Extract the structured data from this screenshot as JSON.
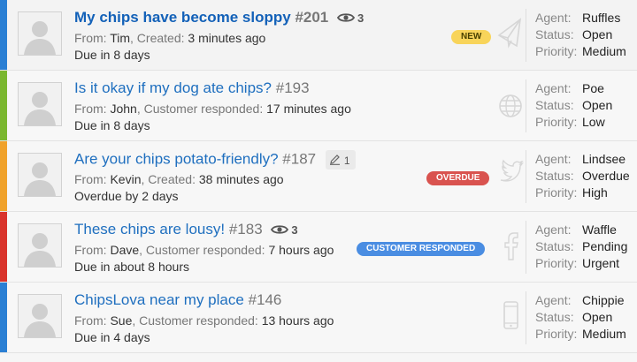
{
  "tickets": [
    {
      "title": "My chips have become sloppy",
      "number": "#201",
      "bold": true,
      "viewers": "3",
      "stripe_color": "#2a7fd4",
      "from_label": "From:",
      "from_name": "Tim",
      "event_label": "Created:",
      "event_time": "3 minutes ago",
      "due": "Due in 8 days",
      "badge": "NEW",
      "badge_kind": "new",
      "channel_icon": "email-icon",
      "agent": "Ruffles",
      "status": "Open",
      "priority": "Medium"
    },
    {
      "title": "Is it okay if my dog ate chips?",
      "number": "#193",
      "bold": false,
      "stripe_color": "#7ab72f",
      "from_label": "From:",
      "from_name": "John",
      "event_label": "Customer responded:",
      "event_time": "17 minutes ago",
      "due": "Due in 8 days",
      "channel_icon": "globe-icon",
      "agent": "Poe",
      "status": "Open",
      "priority": "Low"
    },
    {
      "title": "Are your chips potato-friendly?",
      "number": "#187",
      "bold": false,
      "notes": "1",
      "stripe_color": "#f0a22b",
      "from_label": "From:",
      "from_name": "Kevin",
      "event_label": "Created:",
      "event_time": "38 minutes ago",
      "due": "Overdue by 2 days",
      "badge": "OVERDUE",
      "badge_kind": "overdue",
      "channel_icon": "twitter-icon",
      "agent": "Lindsee",
      "status": "Overdue",
      "priority": "High"
    },
    {
      "title": "These chips are lousy!",
      "number": "#183",
      "bold": false,
      "viewers": "3",
      "stripe_color": "#d9332b",
      "from_label": "From:",
      "from_name": "Dave",
      "event_label": "Customer responded:",
      "event_time": "7 hours ago",
      "due": "Due in about 8 hours",
      "badge": "CUSTOMER RESPONDED",
      "badge_kind": "responded",
      "channel_icon": "facebook-icon",
      "agent": "Waffle",
      "status": "Pending",
      "priority": "Urgent"
    },
    {
      "title": "ChipsLova near my place",
      "number": "#146",
      "bold": false,
      "stripe_color": "#2a7fd4",
      "from_label": "From:",
      "from_name": "Sue",
      "event_label": "Customer responded:",
      "event_time": "13 hours ago",
      "due": "Due in 4 days",
      "channel_icon": "phone-icon",
      "agent": "Chippie",
      "status": "Open",
      "priority": "Medium"
    }
  ],
  "labels": {
    "agent": "Agent:",
    "status": "Status:",
    "priority": "Priority:"
  }
}
